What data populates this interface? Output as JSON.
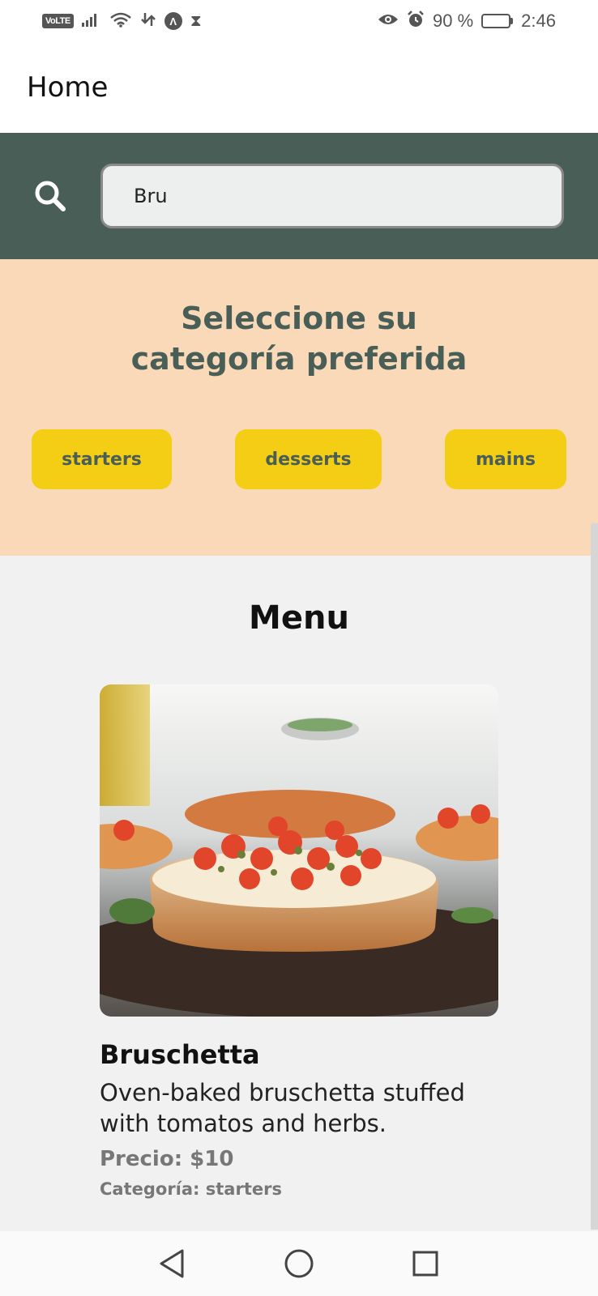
{
  "status_bar": {
    "volte": "VoLTE",
    "battery_percent": "90 %",
    "battery_level": 0.9,
    "time": "2:46",
    "icons": [
      "signal-icon",
      "wifi-icon",
      "data-icon",
      "vpn-icon",
      "hourglass-icon",
      "eye-icon",
      "alarm-icon",
      "battery-icon"
    ]
  },
  "app_bar": {
    "title": "Home"
  },
  "search": {
    "value": "Bru",
    "icon": "search-icon"
  },
  "categories": {
    "heading": "Seleccione su categoría preferida",
    "items": [
      {
        "label": "starters"
      },
      {
        "label": "desserts"
      },
      {
        "label": "mains"
      }
    ]
  },
  "menu": {
    "title": "Menu",
    "items": [
      {
        "name": "Bruschetta",
        "description": "Oven-baked bruschetta stuffed with tomatos and herbs.",
        "price": "Precio: $10",
        "category": "Categoría: starters",
        "image": "bruschetta-photo"
      }
    ]
  },
  "nav": {
    "buttons": [
      "back-icon",
      "home-icon",
      "recents-icon"
    ]
  },
  "colors": {
    "primary_green": "#495e57",
    "accent_yellow": "#f4ce14",
    "peach": "#fad9b8"
  }
}
